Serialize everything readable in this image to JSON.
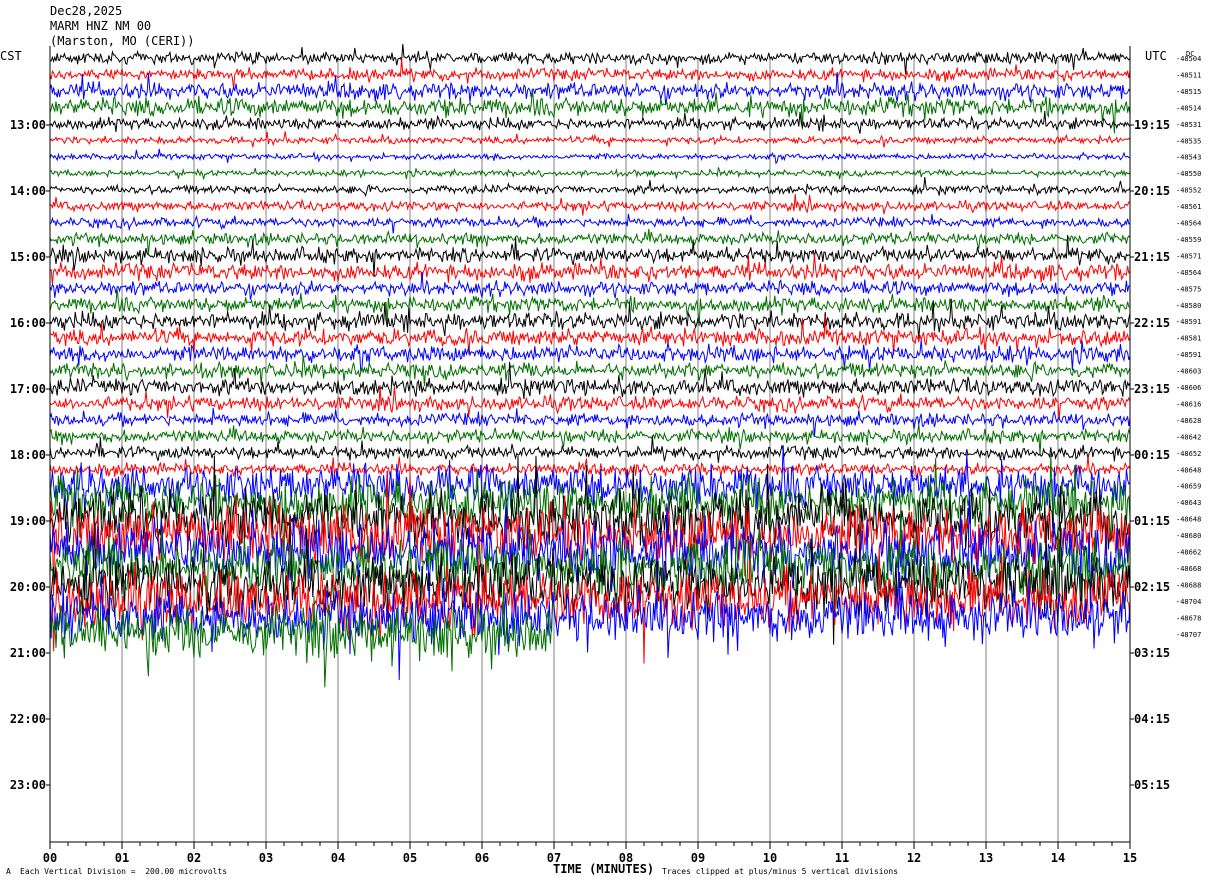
{
  "header": {
    "date": "Dec28,2025",
    "station": "MARM HNZ NM 00",
    "location": "(Marston, MO (CERI))",
    "left_timezone": "CST",
    "right_timezone": "UTC",
    "dc_label": "DC"
  },
  "footer": {
    "scale_note": "Each Vertical Division =  200.00 microvolts",
    "xlabel": "TIME (MINUTES)",
    "clip_note": "Traces clipped at plus/minus 5 vertical divisions",
    "corner_mark": "A"
  },
  "chart_data": {
    "type": "line",
    "title": "MARM HNZ NM 00",
    "xlabel": "TIME (MINUTES)",
    "xlim": [
      0,
      15
    ],
    "x_ticks": [
      "00",
      "01",
      "02",
      "03",
      "04",
      "05",
      "06",
      "07",
      "08",
      "09",
      "10",
      "11",
      "12",
      "13",
      "14",
      "15"
    ],
    "left_hour_labels": [
      "13:00",
      "14:00",
      "15:00",
      "16:00",
      "17:00",
      "18:00",
      "19:00",
      "20:00",
      "21:00",
      "22:00",
      "23:00"
    ],
    "right_hour_labels": [
      "19:15",
      "20:15",
      "21:15",
      "22:15",
      "23:15",
      "00:15",
      "01:15",
      "02:15",
      "03:15",
      "04:15",
      "05:15"
    ],
    "trace_color_cycle": [
      "#000000",
      "#ff0000",
      "#0000ff",
      "#007000"
    ],
    "grid": "vertical lines each minute",
    "dc_offsets": [
      "-48504",
      "-48511",
      "-48515",
      "-48514",
      "-48531",
      "-48535",
      "-48543",
      "-48550",
      "-48552",
      "-48561",
      "-48564",
      "-48559",
      "-48571",
      "-48564",
      "-48575",
      "-48580",
      "-48591",
      "-48581",
      "-48591",
      "-48603",
      "-48606",
      "-48616",
      "-48628",
      "-48642",
      "-48652",
      "-48648",
      "-48659",
      "-48643",
      "-48648",
      "-48680",
      "-48662",
      "-48668",
      "-48688",
      "-48704",
      "-48678",
      "-48707"
    ],
    "trace_amplitude": [
      1.0,
      1.0,
      1.4,
      1.6,
      1.0,
      0.6,
      0.5,
      0.5,
      0.7,
      0.8,
      0.8,
      1.0,
      1.3,
      1.4,
      1.2,
      1.3,
      1.5,
      1.4,
      1.4,
      1.3,
      1.4,
      1.2,
      1.1,
      1.1,
      1.1,
      1.0,
      3.5,
      4.0,
      5.0,
      5.0,
      5.0,
      5.0,
      5.0,
      5.0,
      4.5,
      4.5
    ],
    "partial_last_trace_end_minute": 7.0,
    "clipped_at_divisions": 5,
    "units_per_division": "200.00 microvolts"
  }
}
